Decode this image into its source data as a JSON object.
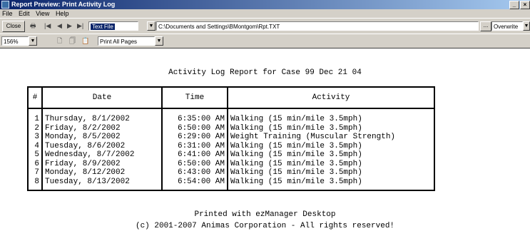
{
  "window": {
    "title": "Report Preview: Print Activity Log",
    "buttons": [
      "_",
      "×"
    ]
  },
  "menu": [
    "File",
    "Edit",
    "View",
    "Help"
  ],
  "toolbar": {
    "close_label": "Close",
    "format_select": "Text File",
    "path": "C:\\Documents and Settings\\BMontgom\\Rpt.TXT",
    "browse_label": "...",
    "mode_select": "Overwrite",
    "zoom": "156%",
    "pages_select": "Print All Pages"
  },
  "report": {
    "title": "Activity Log Report for Case 99 Dec 21 04",
    "columns": [
      "#",
      "Date",
      "Time",
      "Activity"
    ],
    "rows": [
      {
        "n": "1",
        "date": "Thursday, 8/1/2002",
        "time": "6:35:00 AM",
        "activity": "Walking (15 min/mile 3.5mph)"
      },
      {
        "n": "2",
        "date": "Friday, 8/2/2002",
        "time": "6:50:00 AM",
        "activity": "Walking (15 min/mile 3.5mph)"
      },
      {
        "n": "3",
        "date": "Monday, 8/5/2002",
        "time": "6:29:00 AM",
        "activity": "Weight Training (Muscular Strength)"
      },
      {
        "n": "4",
        "date": "Tuesday, 8/6/2002",
        "time": "6:31:00 AM",
        "activity": "Walking (15 min/mile 3.5mph)"
      },
      {
        "n": "5",
        "date": "Wednesday, 8/7/2002",
        "time": "6:41:00 AM",
        "activity": "Walking (15 min/mile 3.5mph)"
      },
      {
        "n": "6",
        "date": "Friday, 8/9/2002",
        "time": "6:50:00 AM",
        "activity": "Walking (15 min/mile 3.5mph)"
      },
      {
        "n": "7",
        "date": "Monday, 8/12/2002",
        "time": "6:43:00 AM",
        "activity": "Walking (15 min/mile 3.5mph)"
      },
      {
        "n": "8",
        "date": "Tuesday, 8/13/2002",
        "time": "6:54:00 AM",
        "activity": "Walking (15 min/mile 3.5mph)"
      }
    ],
    "footer_line1": "Printed with ezManager Desktop",
    "footer_line2": "(c) 2001-2007 Animas Corporation - All rights reserved!"
  }
}
